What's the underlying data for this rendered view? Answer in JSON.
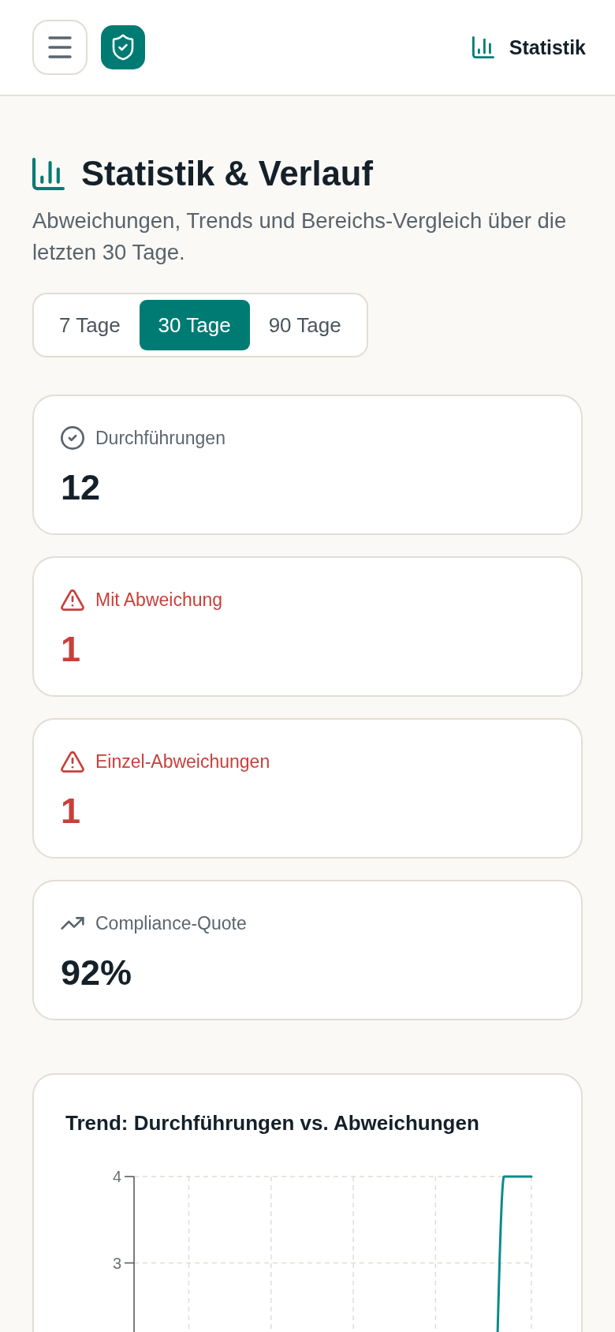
{
  "header": {
    "page_label": "Statistik"
  },
  "page": {
    "title": "Statistik & Verlauf",
    "subtitle": "Abweichungen, Trends und Bereichs-Vergleich über die letzten 30 Tage."
  },
  "period_tabs": [
    {
      "label": "7 Tage",
      "selected": false
    },
    {
      "label": "30 Tage",
      "selected": true
    },
    {
      "label": "90 Tage",
      "selected": false
    }
  ],
  "stat_cards": [
    {
      "kind": "count",
      "label": "Durchführungen",
      "value": "12"
    },
    {
      "kind": "deviation",
      "label": "Mit Abweichung",
      "value": "1"
    },
    {
      "kind": "deviation",
      "label": "Einzel-Abweichungen",
      "value": "1"
    },
    {
      "kind": "rate",
      "label": "Compliance-Quote",
      "value": "92%"
    }
  ],
  "trend_card": {
    "title": "Trend: Durchführungen vs. Abweichungen",
    "y_axis_labels": [
      "4",
      "3"
    ]
  }
}
